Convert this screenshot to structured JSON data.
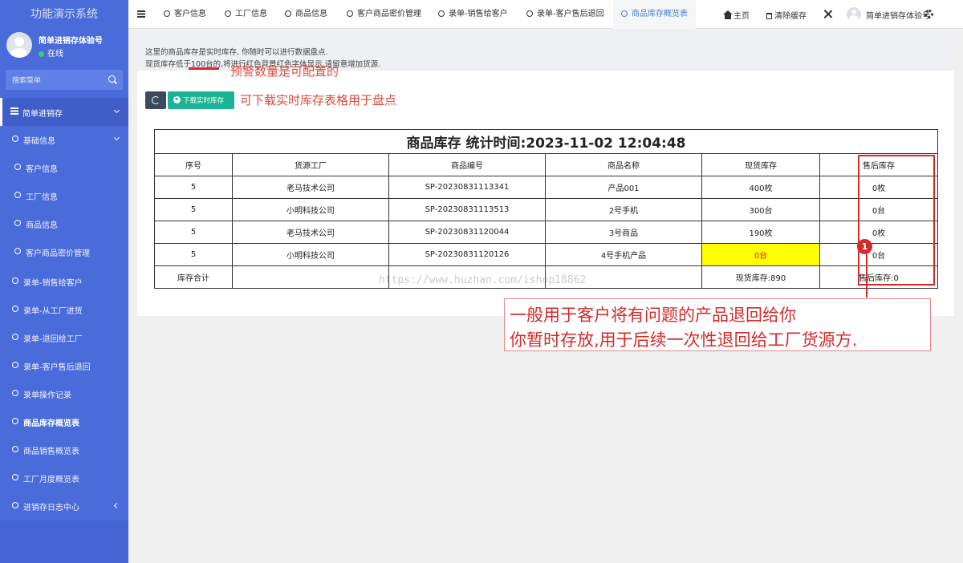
{
  "sidebar": {
    "title": "功能演示系统",
    "user": {
      "name": "简单进销存体验号",
      "status": "在线"
    },
    "search_placeholder": "搜索菜单",
    "section": "简单进销存",
    "items": [
      {
        "label": "基础信息"
      },
      {
        "label": "客户信息"
      },
      {
        "label": "工厂信息"
      },
      {
        "label": "商品信息"
      },
      {
        "label": "客户商品密价管理"
      },
      {
        "label": "录单-销售给客户"
      },
      {
        "label": "录单-从工厂进货"
      },
      {
        "label": "录单-退回给工厂"
      },
      {
        "label": "录单-客户售后退回"
      },
      {
        "label": "录单操作记录"
      },
      {
        "label": "商品库存概览表"
      },
      {
        "label": "商品销售概览表"
      },
      {
        "label": "工厂月度概览表"
      },
      {
        "label": "进销存日志中心"
      }
    ]
  },
  "topbar": {
    "tabs": [
      {
        "label": "客户信息"
      },
      {
        "label": "工厂信息"
      },
      {
        "label": "商品信息"
      },
      {
        "label": "客户商品密价管理"
      },
      {
        "label": "录单-销售给客户"
      },
      {
        "label": "录单-客户售后退回"
      },
      {
        "label": "商品库存概览表"
      }
    ],
    "home": "主页",
    "clear_cache": "清除缓存",
    "user": "简单进销存体验号"
  },
  "notice": {
    "line1": "这里的商品库存是实时库存, 你随时可以进行数据盘点.",
    "line2": "现货库存低于100台的,将进行红色背景红色字体显示,请留意增加货源."
  },
  "annotations": {
    "threshold_note": "预警数量是可配置的",
    "download_note": "可下载实时库存表格用于盘点",
    "badge": "1",
    "callout_line1": "一般用于客户将有问题的产品退回给你",
    "callout_line2": "你暂时存放,用于后续一次性退回给工厂货源方."
  },
  "buttons": {
    "download": "下载实时库存"
  },
  "report": {
    "title": "商品库存 统计时间:2023-11-02 12:04:48",
    "headers": [
      "序号",
      "货源工厂",
      "商品编号",
      "商品名称",
      "现货库存",
      "售后库存"
    ],
    "rows": [
      [
        "5",
        "老马技术公司",
        "SP-20230831113341",
        "产品001",
        "400枚",
        "0枚"
      ],
      [
        "5",
        "小明科技公司",
        "SP-20230831113513",
        "2号手机",
        "300台",
        "0台"
      ],
      [
        "5",
        "老马技术公司",
        "SP-20230831120044",
        "3号商品",
        "190枚",
        "0枚"
      ],
      [
        "5",
        "小明科技公司",
        "SP-20230831120126",
        "4号手机产品",
        "0台",
        "0台"
      ]
    ],
    "totals": {
      "label": "库存合计",
      "stock": "现货库存:890",
      "after_sales": "售后库存:0"
    }
  },
  "watermark": "https://www.huzhan.com/ishop18862"
}
